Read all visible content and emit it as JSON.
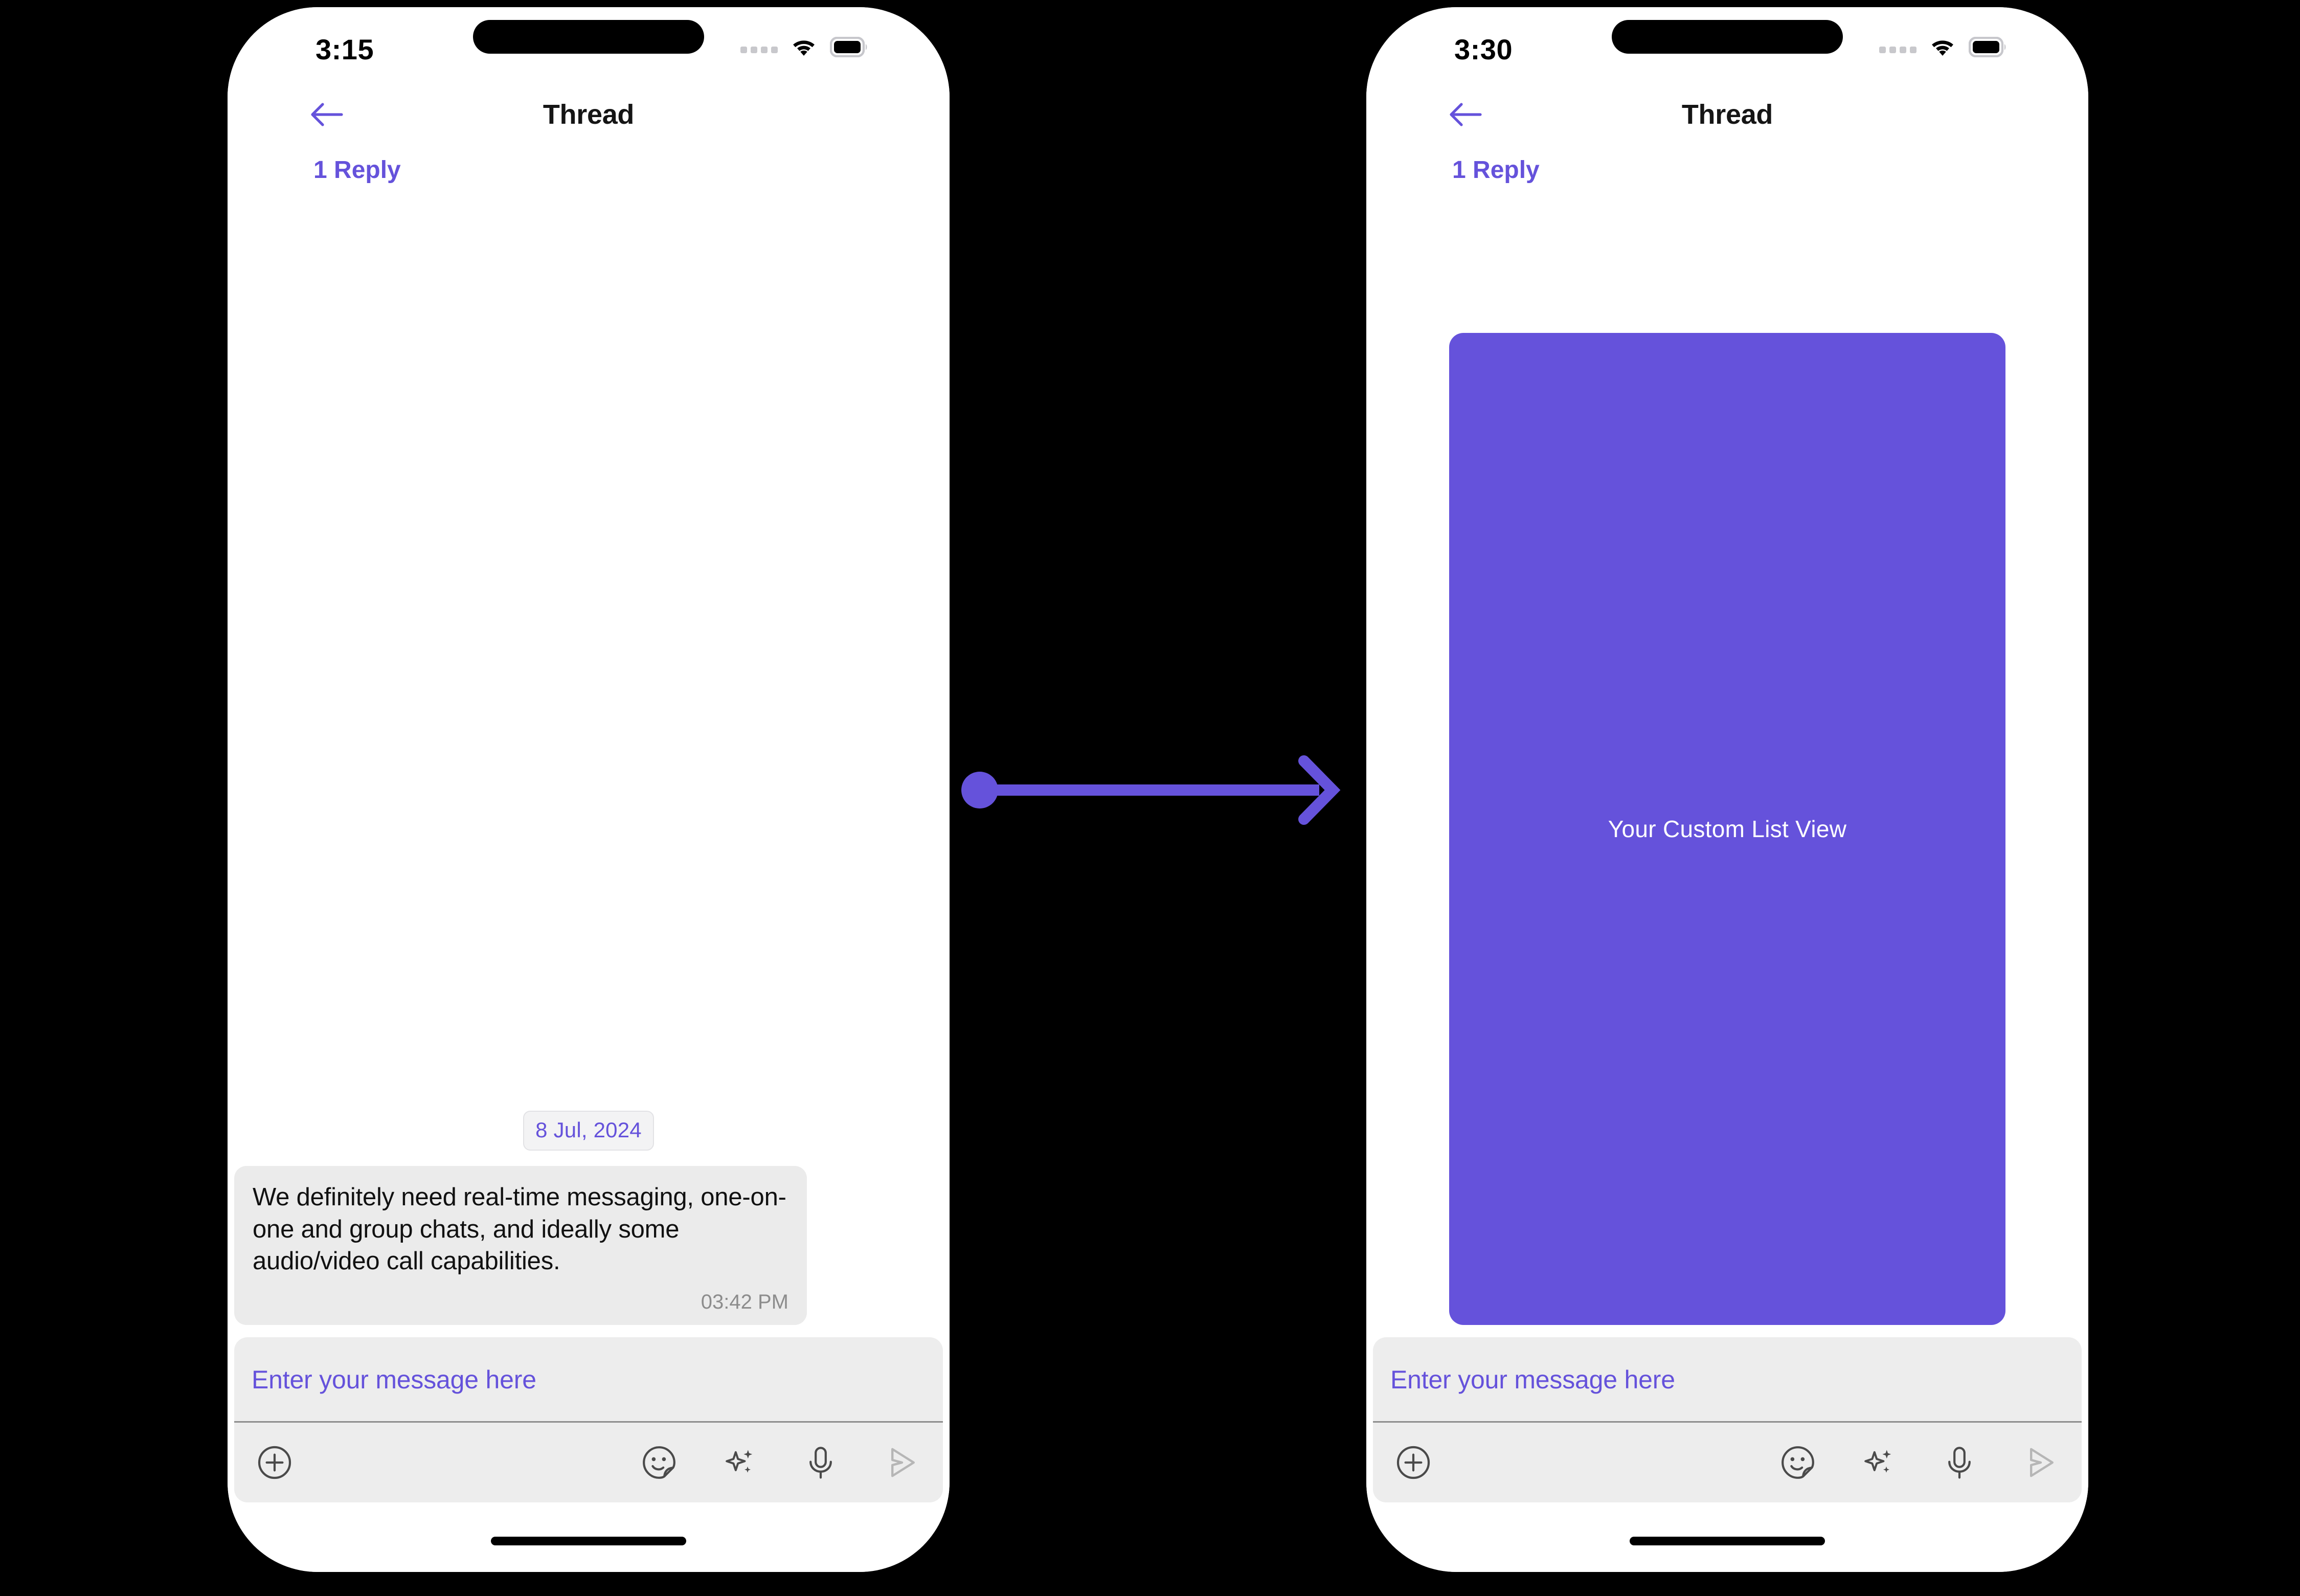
{
  "theme": {
    "accent": "#6552DB",
    "bubble_bg": "#ebebeb",
    "composer_bg": "#ededed",
    "screen_bg": "#ffffff",
    "page_bg": "#000000",
    "timestamp_color": "#8c8c8c"
  },
  "screens": [
    {
      "id": "before",
      "status_bar": {
        "time": "3:15",
        "cellular_icon": "cellular-dots-icon",
        "wifi_icon": "wifi-icon",
        "battery_icon": "battery-icon"
      },
      "nav": {
        "back_icon": "back-arrow-icon",
        "title": "Thread"
      },
      "reply_count": "1 Reply",
      "date_chip": "8 Jul, 2024",
      "message": {
        "text": "We definitely need real-time messaging, one-on-one and group chats, and ideally some audio/video call capabilities.",
        "time": "03:42 PM"
      },
      "composer": {
        "placeholder": "Enter your message here",
        "tools": [
          {
            "name": "attachment-plus-icon",
            "label": "Attachment"
          },
          {
            "name": "sticker-icon",
            "label": "Sticker"
          },
          {
            "name": "ai-sparkle-icon",
            "label": "AI Assist"
          },
          {
            "name": "microphone-icon",
            "label": "Voice"
          },
          {
            "name": "send-icon",
            "label": "Send"
          }
        ]
      }
    },
    {
      "id": "after",
      "status_bar": {
        "time": "3:30",
        "cellular_icon": "cellular-dots-icon",
        "wifi_icon": "wifi-icon",
        "battery_icon": "battery-icon"
      },
      "nav": {
        "back_icon": "back-arrow-icon",
        "title": "Thread"
      },
      "reply_count": "1 Reply",
      "custom_view_label": "Your Custom List View",
      "composer": {
        "placeholder": "Enter your message here",
        "tools": [
          {
            "name": "attachment-plus-icon",
            "label": "Attachment"
          },
          {
            "name": "sticker-icon",
            "label": "Sticker"
          },
          {
            "name": "ai-sparkle-icon",
            "label": "AI Assist"
          },
          {
            "name": "microphone-icon",
            "label": "Voice"
          },
          {
            "name": "send-icon",
            "label": "Send"
          }
        ]
      }
    }
  ],
  "connector": {
    "icon": "arrow-right-icon",
    "color": "#6552DB"
  }
}
